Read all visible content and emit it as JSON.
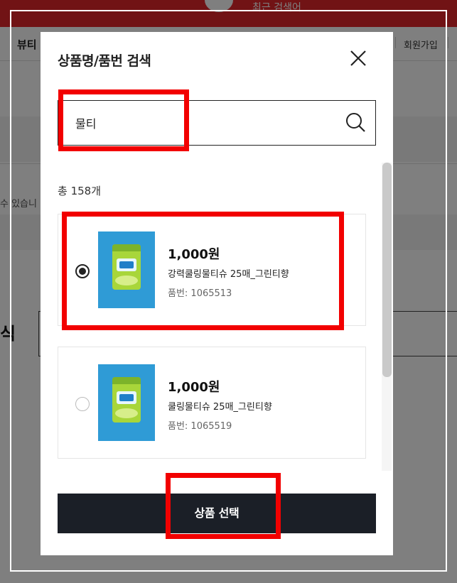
{
  "background": {
    "search_text": "최근 검색어",
    "nav_beauty": "뷰티",
    "nav_signup": "회원가입",
    "note_fragment": "수 있습니",
    "title_fragment": "식"
  },
  "modal": {
    "title": "상품명/품번 검색",
    "search": {
      "value": "물티",
      "placeholder": ""
    },
    "total_prefix": "총 ",
    "total_count": "158개",
    "products": [
      {
        "price": "1,000원",
        "name": "강력쿨링물티슈 25매_그린티향",
        "code": "품번: 1065513",
        "selected": true
      },
      {
        "price": "1,000원",
        "name": "쿨링물티슈 25매_그린티향",
        "code": "품번: 1065519",
        "selected": false
      }
    ],
    "select_button": "상품 선택"
  },
  "colors": {
    "brand_red": "#e2262a",
    "highlight": "#f20000",
    "button_dark": "#1b1f27",
    "thumb_blue": "#2f9bd6",
    "pack_green": "#a8d63a"
  },
  "icons": {
    "close": "close-icon",
    "search": "search-icon"
  }
}
